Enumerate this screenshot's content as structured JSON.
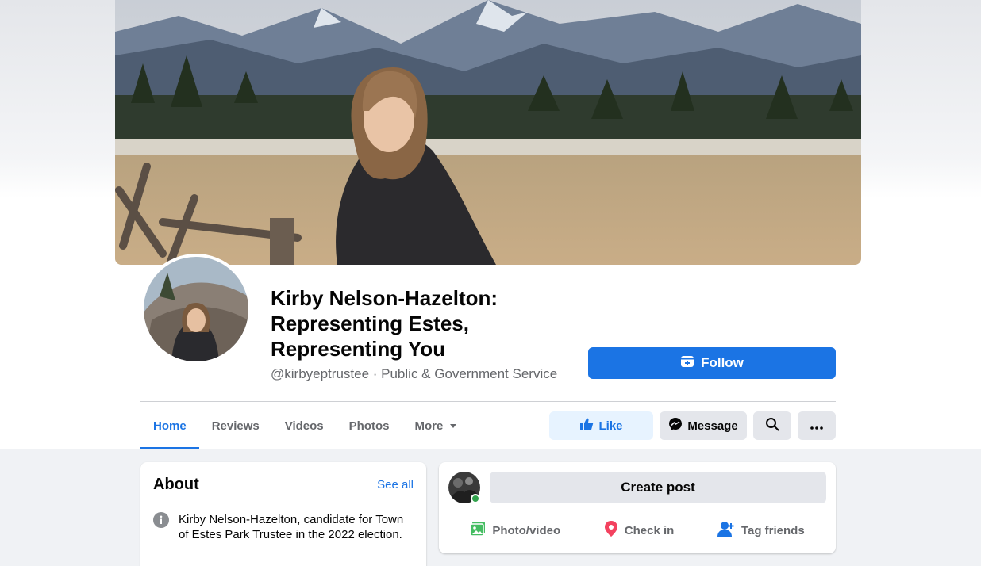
{
  "page": {
    "name": "Kirby Nelson-Hazelton: Representing Estes, Representing You",
    "handle": "@kirbyeptrustee",
    "category": "Public & Government Service",
    "subline": "@kirbyeptrustee · Public & Government Service"
  },
  "header": {
    "follow_label": "Follow"
  },
  "tabs": [
    {
      "label": "Home",
      "active": true
    },
    {
      "label": "Reviews",
      "active": false
    },
    {
      "label": "Videos",
      "active": false
    },
    {
      "label": "Photos",
      "active": false
    },
    {
      "label": "More",
      "active": false
    }
  ],
  "actions": {
    "like_label": "Like",
    "message_label": "Message",
    "search_icon": "search-icon",
    "more_icon": "more-dots-icon"
  },
  "about": {
    "title": "About",
    "see_all": "See all",
    "description": "Kirby Nelson-Hazelton, candidate for Town of Estes Park Trustee in the 2022 election."
  },
  "composer": {
    "create_post": "Create post",
    "photo_video": "Photo/video",
    "check_in": "Check in",
    "tag_friends": "Tag friends"
  },
  "colors": {
    "accent": "#1b74e4",
    "like_bg": "#e7f3ff",
    "online": "#31a24c",
    "photo_green": "#45bd62",
    "checkin_red": "#f3425f"
  }
}
